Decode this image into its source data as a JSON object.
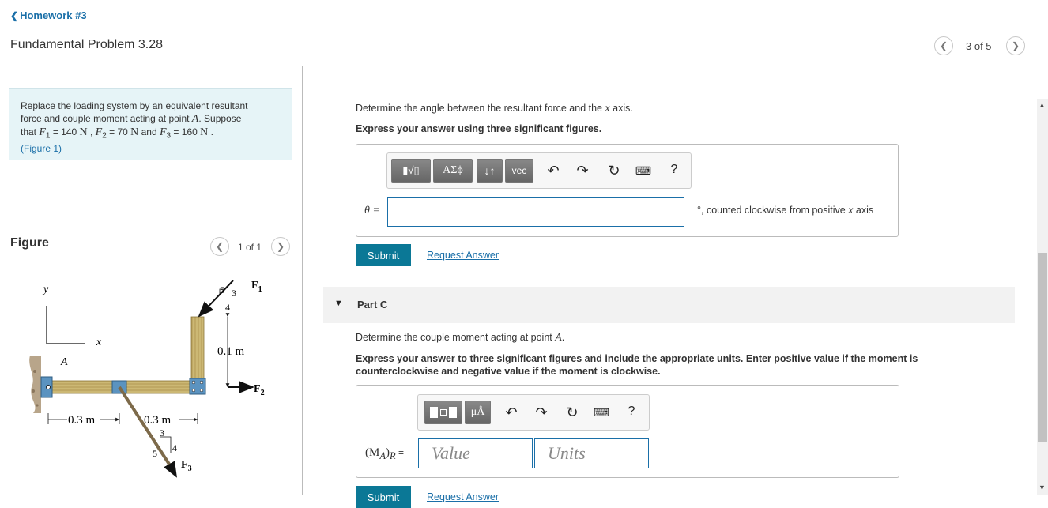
{
  "header": {
    "back_label": "Homework #3",
    "problem_title": "Fundamental Problem 3.28",
    "pager": "3 of 5"
  },
  "intro": {
    "line1": "Replace the loading system by an equivalent resultant",
    "line2a": "force and couple moment acting at point ",
    "point": "A",
    "line2b": ". Suppose",
    "that": "that ",
    "F1": "F",
    "F1sub": "1",
    "eq140": " = 140 ",
    "N": "N",
    "comma": " , ",
    "F2sub": "2",
    "eq70": " = 70 ",
    "and": " and ",
    "F3sub": "3",
    "eq160": " = 160 ",
    "period": " .",
    "figure_link": "(Figure 1)"
  },
  "figure": {
    "label": "Figure",
    "pager": "1 of 1",
    "labels": {
      "y": "y",
      "x": "x",
      "A": "A",
      "dim1": "0.3 m",
      "dim2": "0.3 m",
      "dim3": "0.1 m",
      "F1": "F",
      "F1sub": "1",
      "F2": "F",
      "F2sub": "2",
      "F3": "F",
      "F3sub": "3",
      "t5a": "5",
      "t3a": "3",
      "t4a": "4",
      "t3b": "3",
      "t5b": "5",
      "t4b": "4"
    }
  },
  "partB": {
    "question": "Determine the angle between the resultant force and the ",
    "xaxis": "x",
    "axis_word": " axis.",
    "instruction": "Express your answer using three significant figures.",
    "toolbar": {
      "templates": "▮√▯",
      "greek": "ΑΣϕ",
      "arrows": "↓↑",
      "vec": "vec",
      "help": "?"
    },
    "theta_label": "θ =",
    "unit_text": "°, counted clockwise from positive ",
    "unit_x": "x",
    "unit_axis": " axis",
    "submit": "Submit",
    "request": "Request Answer"
  },
  "partC": {
    "title": "Part C",
    "question": "Determine the couple moment acting at point ",
    "point": "A",
    "period": ".",
    "instruction_line1": "Express your answer to three significant figures and include the appropriate units. Enter positive value if the moment is",
    "instruction_line2": "counterclockwise and negative value if the moment is clockwise.",
    "toolbar": {
      "units": "μÅ",
      "help": "?"
    },
    "label": "(M",
    "label_sub": "A",
    "label_end": ")",
    "label_R": "R",
    "label_eq": " =",
    "value_placeholder": "Value",
    "units_placeholder": "Units",
    "submit": "Submit",
    "request": "Request Answer"
  },
  "colors": {
    "link": "#1a6fa8",
    "submit": "#0b7896",
    "intro_bg": "#e6f4f7"
  }
}
